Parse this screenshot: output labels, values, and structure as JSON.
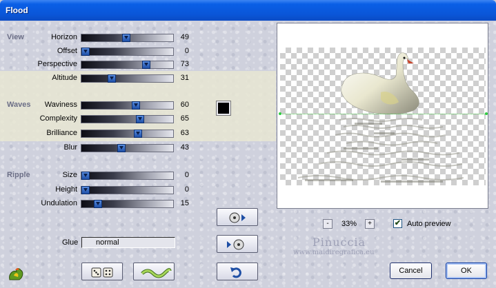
{
  "window": {
    "title": "Flood"
  },
  "groups": {
    "view": "View",
    "waves": "Waves",
    "ripple": "Ripple"
  },
  "sliders": [
    {
      "id": "horizon",
      "label": "Horizon",
      "value": 49
    },
    {
      "id": "offset",
      "label": "Offset",
      "value": 0
    },
    {
      "id": "perspective",
      "label": "Perspective",
      "value": 73
    },
    {
      "id": "altitude",
      "label": "Altitude",
      "value": 31
    },
    {
      "id": "waviness",
      "label": "Waviness",
      "value": 60
    },
    {
      "id": "complexity",
      "label": "Complexity",
      "value": 65
    },
    {
      "id": "brilliance",
      "label": "Brilliance",
      "value": 63
    },
    {
      "id": "blur",
      "label": "Blur",
      "value": 43
    },
    {
      "id": "size",
      "label": "Size",
      "value": 0
    },
    {
      "id": "height",
      "label": "Height",
      "value": 0
    },
    {
      "id": "undulation",
      "label": "Undulation",
      "value": 15
    }
  ],
  "waves_color": "#000000",
  "glue": {
    "label": "Glue",
    "value": "normal"
  },
  "zoom": {
    "minus": "-",
    "value": "33%",
    "plus": "+"
  },
  "auto_preview": {
    "label": "Auto preview",
    "checked": true,
    "mark": "✔"
  },
  "watermark": {
    "line1": "Pinuccia",
    "line2": "www.maidiregrafica.eu"
  },
  "buttons": {
    "cancel": "Cancel",
    "ok": "OK",
    "icons": [
      "randomize-dice-icon",
      "wave-preset-icon",
      "save-preset-icon",
      "load-preset-icon",
      "reset-icon"
    ]
  }
}
